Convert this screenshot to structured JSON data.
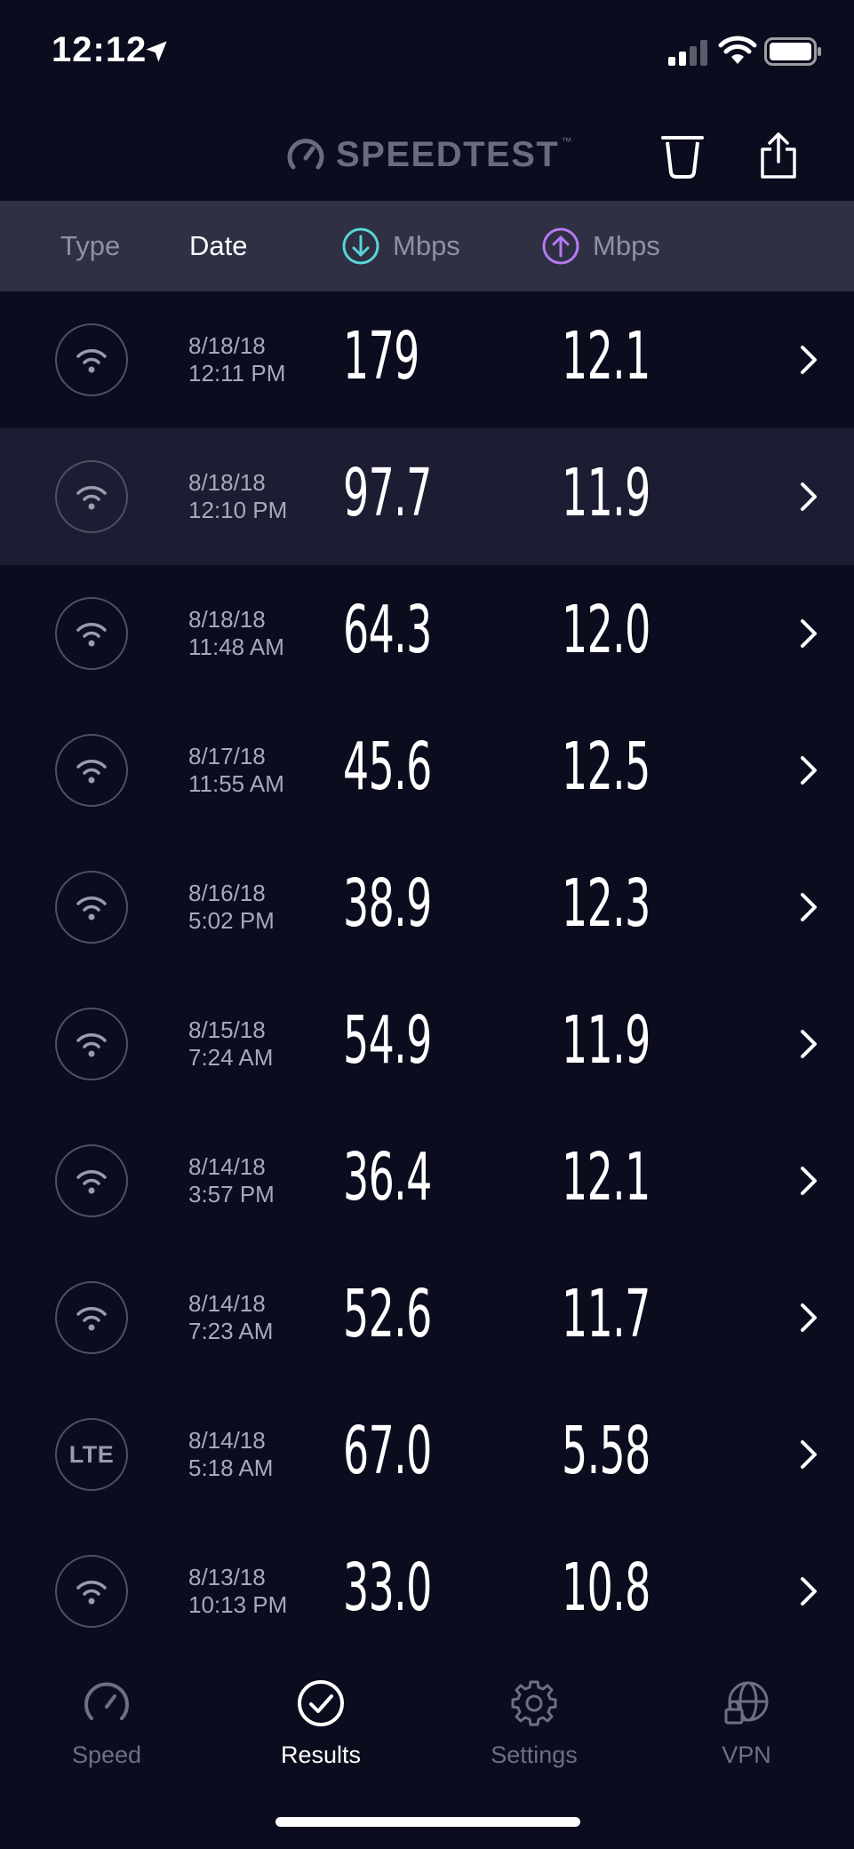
{
  "status_bar": {
    "time": "12:12",
    "icons": [
      "location-arrow-icon",
      "cellular-signal-icon",
      "wifi-icon",
      "battery-icon"
    ]
  },
  "header": {
    "logo_text": "SPEEDTEST",
    "logo_tm": "™",
    "actions": [
      "trash-icon",
      "share-icon"
    ]
  },
  "columns": {
    "type": "Type",
    "date": "Date",
    "download": "Mbps",
    "upload": "Mbps"
  },
  "colors": {
    "background": "#0b0c1d",
    "header_bar": "#2f3044",
    "highlight_row": "#1c1d33",
    "download_accent": "#58d6d6",
    "upload_accent": "#b57af0"
  },
  "results": [
    {
      "type": "wifi",
      "date": "8/18/18",
      "time": "12:11 PM",
      "down": "179",
      "up": "12.1"
    },
    {
      "type": "wifi",
      "date": "8/18/18",
      "time": "12:10 PM",
      "down": "97.7",
      "up": "11.9"
    },
    {
      "type": "wifi",
      "date": "8/18/18",
      "time": "11:48 AM",
      "down": "64.3",
      "up": "12.0"
    },
    {
      "type": "wifi",
      "date": "8/17/18",
      "time": "11:55 AM",
      "down": "45.6",
      "up": "12.5"
    },
    {
      "type": "wifi",
      "date": "8/16/18",
      "time": "5:02 PM",
      "down": "38.9",
      "up": "12.3"
    },
    {
      "type": "wifi",
      "date": "8/15/18",
      "time": "7:24 AM",
      "down": "54.9",
      "up": "11.9"
    },
    {
      "type": "wifi",
      "date": "8/14/18",
      "time": "3:57 PM",
      "down": "36.4",
      "up": "12.1"
    },
    {
      "type": "wifi",
      "date": "8/14/18",
      "time": "7:23 AM",
      "down": "52.6",
      "up": "11.7"
    },
    {
      "type": "lte",
      "type_label": "LTE",
      "date": "8/14/18",
      "time": "5:18 AM",
      "down": "67.0",
      "up": "5.58"
    },
    {
      "type": "wifi",
      "date": "8/13/18",
      "time": "10:13 PM",
      "down": "33.0",
      "up": "10.8"
    }
  ],
  "tabs": [
    {
      "label": "Speed",
      "icon": "speedometer-icon"
    },
    {
      "label": "Results",
      "icon": "checkmark-circle-icon"
    },
    {
      "label": "Settings",
      "icon": "gear-icon"
    },
    {
      "label": "VPN",
      "icon": "globe-lock-icon"
    }
  ]
}
